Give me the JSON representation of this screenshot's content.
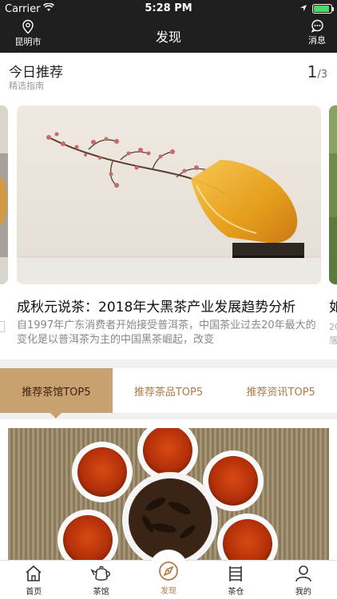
{
  "status": {
    "carrier": "Carrier",
    "time": "5:28 PM"
  },
  "navbar": {
    "location": "昆明市",
    "title": "发现",
    "messages": "消息"
  },
  "recommend": {
    "title": "今日推荐",
    "subtitle": "精选指南",
    "page_current": "1",
    "page_total": "/3"
  },
  "article": {
    "headline": "成秋元说茶：2018年大黑茶产业发展趋势分析",
    "summary": "自1997年广东消费者开始接受普洱茶，中国茶业过去20年最大的变化是以普洱茶为主的中国黑茶崛起，改变",
    "next_headline": "如",
    "next_summary": "20落"
  },
  "tabs": [
    {
      "label": "推荐茶馆TOP5"
    },
    {
      "label": "推荐茶品TOP5"
    },
    {
      "label": "推荐资讯TOP5"
    }
  ],
  "tabbar": [
    {
      "label": "首页",
      "icon": "home-icon"
    },
    {
      "label": "茶馆",
      "icon": "teapot-icon"
    },
    {
      "label": "发现",
      "icon": "compass-icon"
    },
    {
      "label": "茶仓",
      "icon": "shelf-icon"
    },
    {
      "label": "我的",
      "icon": "profile-icon"
    }
  ],
  "colors": {
    "accent": "#b07a45",
    "active_tab": "#c9a070",
    "topbar": "#1f1f1f"
  }
}
